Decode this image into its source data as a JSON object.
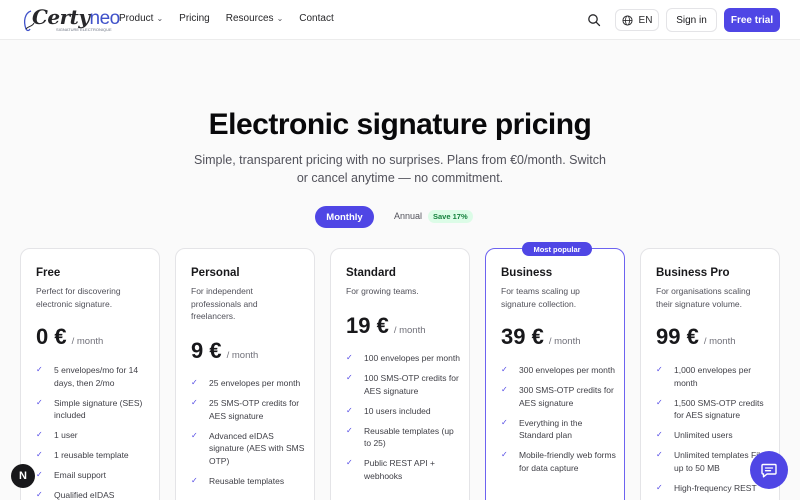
{
  "header": {
    "logo": {
      "brand_main": "Certy",
      "brand_accent": "neo",
      "tagline": "SIGNATURE ÉLECTRONIQUE"
    },
    "nav": [
      {
        "label": "Product",
        "dropdown": true
      },
      {
        "label": "Pricing",
        "dropdown": false
      },
      {
        "label": "Resources",
        "dropdown": true
      },
      {
        "label": "Contact",
        "dropdown": false
      }
    ],
    "language": "EN",
    "sign_in": "Sign in",
    "free_trial": "Free trial"
  },
  "hero": {
    "title": "Electronic signature pricing",
    "subtitle": "Simple, transparent pricing with no surprises. Plans from €0/month. Switch or cancel anytime — no commitment."
  },
  "billing": {
    "monthly": "Monthly",
    "annual": "Annual",
    "save_badge": "Save 17%",
    "selected": "Monthly"
  },
  "plans": [
    {
      "name": "Free",
      "description": "Perfect for discovering electronic signature.",
      "price": "0 €",
      "period": "/ month",
      "popular": false,
      "features": [
        "5 envelopes/mo for 14 days, then 2/mo",
        "Simple signature (SES) included",
        "1 user",
        "1 reusable template",
        "Email support",
        "Qualified eIDAS"
      ]
    },
    {
      "name": "Personal",
      "description": "For independent professionals and freelancers.",
      "price": "9 €",
      "period": "/ month",
      "popular": false,
      "features": [
        "25 envelopes per month",
        "25 SMS-OTP credits for AES signature",
        "Advanced eIDAS signature (AES with SMS OTP)",
        "Reusable templates"
      ]
    },
    {
      "name": "Standard",
      "description": "For growing teams.",
      "price": "19 €",
      "period": "/ month",
      "popular": false,
      "features": [
        "100 envelopes per month",
        "100 SMS-OTP credits for AES signature",
        "10 users included",
        "Reusable templates (up to 25)",
        "Public REST API + webhooks"
      ]
    },
    {
      "name": "Business",
      "description": "For teams scaling up signature collection.",
      "price": "39 €",
      "period": "/ month",
      "popular": true,
      "popular_label": "Most popular",
      "features": [
        "300 envelopes per month",
        "300 SMS-OTP credits for AES signature",
        "Everything in the Standard plan",
        "Mobile-friendly web forms for data capture"
      ]
    },
    {
      "name": "Business Pro",
      "description": "For organisations scaling their signature volume.",
      "price": "99 €",
      "period": "/ month",
      "popular": false,
      "features": [
        "1,000 envelopes per month",
        "1,500 SMS-OTP credits for AES signature",
        "Unlimited users",
        "Unlimited templates Files up to 50 MB",
        "High-frequency REST"
      ]
    }
  ],
  "floating": {
    "next_badge": "N",
    "chat_icon": "chat-bubble-icon"
  },
  "colors": {
    "accent": "#4f46e5",
    "save_badge_bg": "#dcfce7",
    "save_badge_text": "#15803d"
  }
}
